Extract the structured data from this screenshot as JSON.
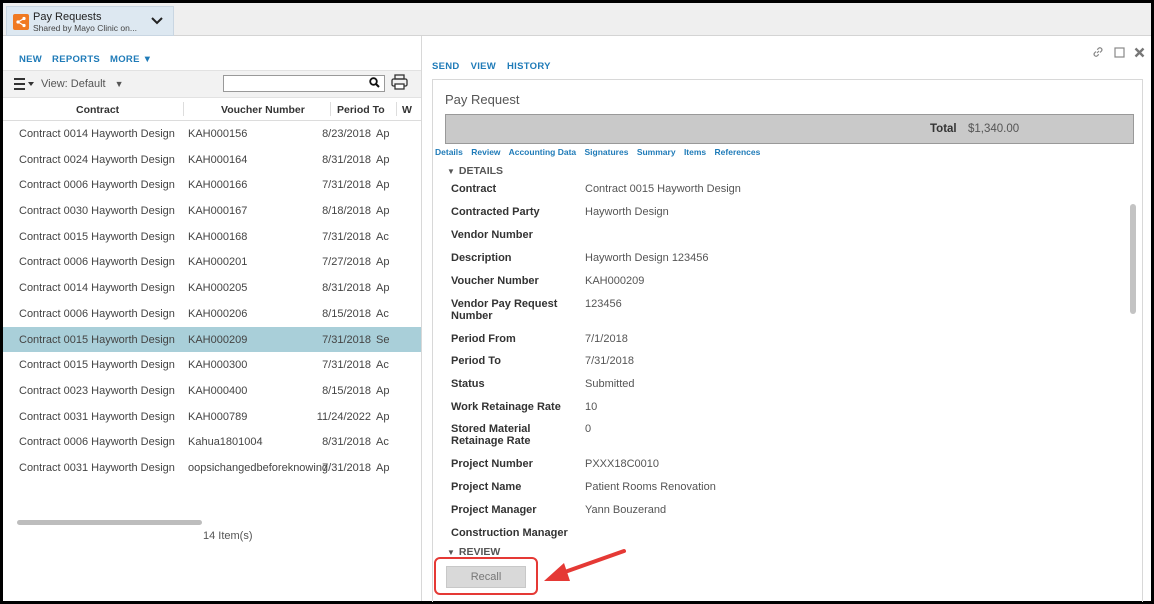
{
  "app": {
    "title": "Pay Requests",
    "subtitle": "Shared by Mayo Clinic on...",
    "chevron_icon": "chevron-down-icon"
  },
  "left": {
    "commands": [
      "NEW",
      "REPORTS",
      "MORE ▼"
    ],
    "view_label": "View: Default",
    "search": {
      "value": "",
      "placeholder": ""
    },
    "columns": [
      "Contract",
      "Voucher Number",
      "Period To",
      "W"
    ],
    "rows": [
      {
        "contract": "Contract 0014 Hayworth Design",
        "voucher": "KAH000156",
        "period_to": "8/23/2018",
        "w": "Ap"
      },
      {
        "contract": "Contract 0024 Hayworth Design",
        "voucher": "KAH000164",
        "period_to": "8/31/2018",
        "w": "Ap"
      },
      {
        "contract": "Contract 0006 Hayworth Design",
        "voucher": "KAH000166",
        "period_to": "7/31/2018",
        "w": "Ap"
      },
      {
        "contract": "Contract 0030 Hayworth Design",
        "voucher": "KAH000167",
        "period_to": "8/18/2018",
        "w": "Ap"
      },
      {
        "contract": "Contract 0015 Hayworth Design",
        "voucher": "KAH000168",
        "period_to": "7/31/2018",
        "w": "Ac"
      },
      {
        "contract": "Contract 0006 Hayworth Design",
        "voucher": "KAH000201",
        "period_to": "7/27/2018",
        "w": "Ap"
      },
      {
        "contract": "Contract 0014 Hayworth Design",
        "voucher": "KAH000205",
        "period_to": "8/31/2018",
        "w": "Ap"
      },
      {
        "contract": "Contract 0006 Hayworth Design",
        "voucher": "KAH000206",
        "period_to": "8/15/2018",
        "w": "Ac"
      },
      {
        "contract": "Contract 0015 Hayworth Design",
        "voucher": "KAH000209",
        "period_to": "7/31/2018",
        "w": "Se"
      },
      {
        "contract": "Contract 0015 Hayworth Design",
        "voucher": "KAH000300",
        "period_to": "7/31/2018",
        "w": "Ac"
      },
      {
        "contract": "Contract 0023 Hayworth Design",
        "voucher": "KAH000400",
        "period_to": "8/15/2018",
        "w": "Ap"
      },
      {
        "contract": "Contract 0031 Hayworth Design",
        "voucher": "KAH000789",
        "period_to": "11/24/2022",
        "w": "Ap"
      },
      {
        "contract": "Contract 0006 Hayworth Design",
        "voucher": "Kahua1801004",
        "period_to": "8/31/2018",
        "w": "Ac"
      },
      {
        "contract": "Contract 0031 Hayworth Design",
        "voucher": "oopsichangedbeforeknowing",
        "period_to": "7/31/2018",
        "w": "Ap"
      }
    ],
    "selected_index": 8,
    "item_count": "14 Item(s)"
  },
  "right": {
    "commands": [
      "SEND",
      "VIEW",
      "HISTORY"
    ],
    "icons": [
      "link-icon",
      "maximize-icon",
      "close-icon"
    ],
    "form_title": "Pay Request",
    "total_label": "Total",
    "total_value": "$1,340.00",
    "tabs": [
      "Details",
      "Review",
      "Accounting Data",
      "Signatures",
      "Summary",
      "Items",
      "References"
    ],
    "details_header": "DETAILS",
    "fields": [
      {
        "label": "Contract",
        "value": "Contract 0015 Hayworth Design"
      },
      {
        "label": "Contracted Party",
        "value": "Hayworth Design"
      },
      {
        "label": "Vendor Number",
        "value": ""
      },
      {
        "label": "Description",
        "value": "Hayworth Design 123456"
      },
      {
        "label": "Voucher Number",
        "value": "KAH000209"
      },
      {
        "label": "Vendor Pay Request Number",
        "value": "123456"
      },
      {
        "label": "Period From",
        "value": "7/1/2018"
      },
      {
        "label": "Period To",
        "value": "7/31/2018"
      },
      {
        "label": "Status",
        "value": "Submitted"
      },
      {
        "label": "Work Retainage Rate",
        "value": "10"
      },
      {
        "label": "Stored Material Retainage Rate",
        "value": "0"
      },
      {
        "label": "Project Number",
        "value": "PXXX18C0010"
      },
      {
        "label": "Project Name",
        "value": "Patient Rooms Renovation"
      },
      {
        "label": "Project Manager",
        "value": "Yann Bouzerand"
      },
      {
        "label": "Construction Manager",
        "value": ""
      }
    ],
    "review_header": "REVIEW",
    "recall_label": "Recall"
  },
  "colors": {
    "accent": "#1f7bb8",
    "selected_row": "#a9cfd9",
    "highlight": "#e53935",
    "app_icon": "#f07a22"
  }
}
